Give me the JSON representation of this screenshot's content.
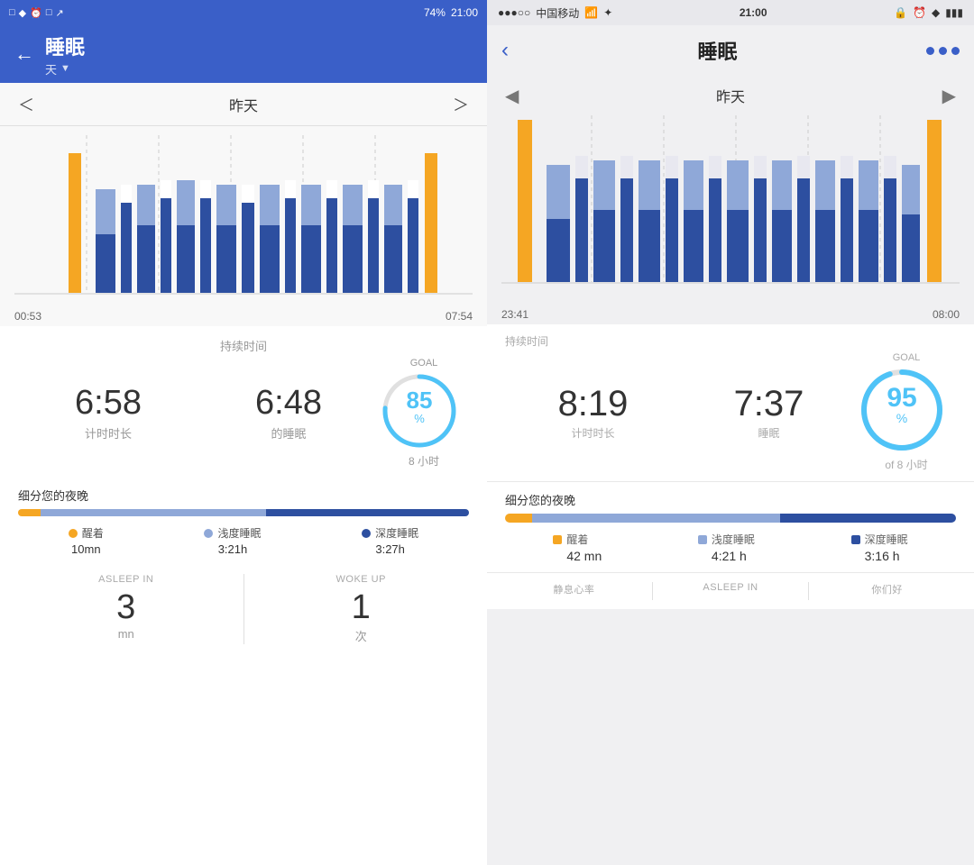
{
  "left": {
    "statusbar": {
      "battery": "74%",
      "time": "21:00",
      "icons": "bluetooth alarm signal"
    },
    "header": {
      "title": "睡眠",
      "subtitle": "天",
      "back_label": "←",
      "dropdown_label": "▼"
    },
    "nav": {
      "prev": "＜",
      "date": "昨天",
      "next": "＞"
    },
    "chart": {
      "start_time": "00:53",
      "end_time": "07:54"
    },
    "stats": {
      "duration_label": "持续时间",
      "goal_label": "GOAL",
      "timer_value": "6:58",
      "timer_desc": "计时时长",
      "sleep_value": "6:48",
      "sleep_desc": "的睡眠",
      "goal_percent": "85",
      "goal_unit": "%",
      "goal_hours": "8 小时"
    },
    "breakdown": {
      "title": "细分您的夜晚",
      "awake_color": "#f5a623",
      "light_color": "#8fa8d8",
      "deep_color": "#2d4fa0",
      "awake_pct": 5,
      "light_pct": 50,
      "deep_pct": 45,
      "awake_label": "醒着",
      "light_label": "浅度睡眠",
      "deep_label": "深度睡眠",
      "awake_val": "10mn",
      "light_val": "3:21h",
      "deep_val": "3:27h"
    },
    "asleep": {
      "asleep_label": "ASLEEP IN",
      "asleep_value": "3",
      "asleep_unit": "mn",
      "woke_label": "WOKE UP",
      "woke_value": "1",
      "woke_unit": "次"
    }
  },
  "right": {
    "statusbar": {
      "left_icons": "●●●○○ 中国移动",
      "wifi": "WiFi",
      "time": "21:00",
      "right_icons": "lock alarm bluetooth battery"
    },
    "header": {
      "back_label": "‹",
      "title": "睡眠",
      "dots_label": "···"
    },
    "nav": {
      "prev": "◀",
      "date": "昨天",
      "next": "▶"
    },
    "chart": {
      "start_time": "23:41",
      "end_time": "08:00"
    },
    "stats": {
      "duration_label": "持续时间",
      "goal_label": "GOAL",
      "timer_value": "8:19",
      "timer_desc": "计时时长",
      "sleep_value": "7:37",
      "sleep_desc": "睡眠",
      "goal_percent": "95",
      "goal_unit": "%",
      "goal_hours": "of 8 小时"
    },
    "breakdown": {
      "title": "细分您的夜晚",
      "awake_color": "#f5a623",
      "light_color": "#8fa8d8",
      "deep_color": "#2d4fa0",
      "awake_pct": 6,
      "light_pct": 55,
      "deep_pct": 39,
      "awake_label": "醒着",
      "light_label": "浅度睡眠",
      "deep_label": "深度睡眠",
      "awake_val": "42 mn",
      "light_val": "4:21 h",
      "deep_val": "3:16 h"
    },
    "bottom": {
      "resting_label": "静息心率",
      "asleep_label": "ASLEEP IN",
      "woke_label": "你们好"
    }
  }
}
